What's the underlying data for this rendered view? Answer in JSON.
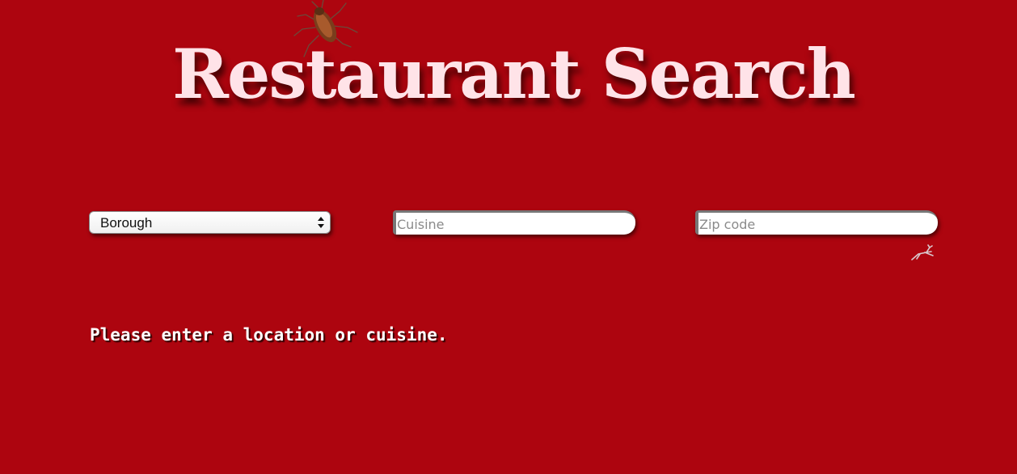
{
  "header": {
    "title": "Restaurant Search"
  },
  "filters": {
    "borough_select": {
      "selected": "Borough",
      "icon": "updown-arrows-icon"
    },
    "cuisine_input": {
      "value": "",
      "placeholder": "Cuisine"
    },
    "zip_input": {
      "value": "",
      "placeholder": "Zip code"
    }
  },
  "decorations": {
    "roach": "cockroach-icon",
    "deer": "leaping-deer-icon"
  },
  "status": {
    "message": "Please enter a location or cuisine."
  },
  "colors": {
    "background": "#ad050f",
    "title": "#ffe3e8",
    "message": "#ffffff"
  }
}
